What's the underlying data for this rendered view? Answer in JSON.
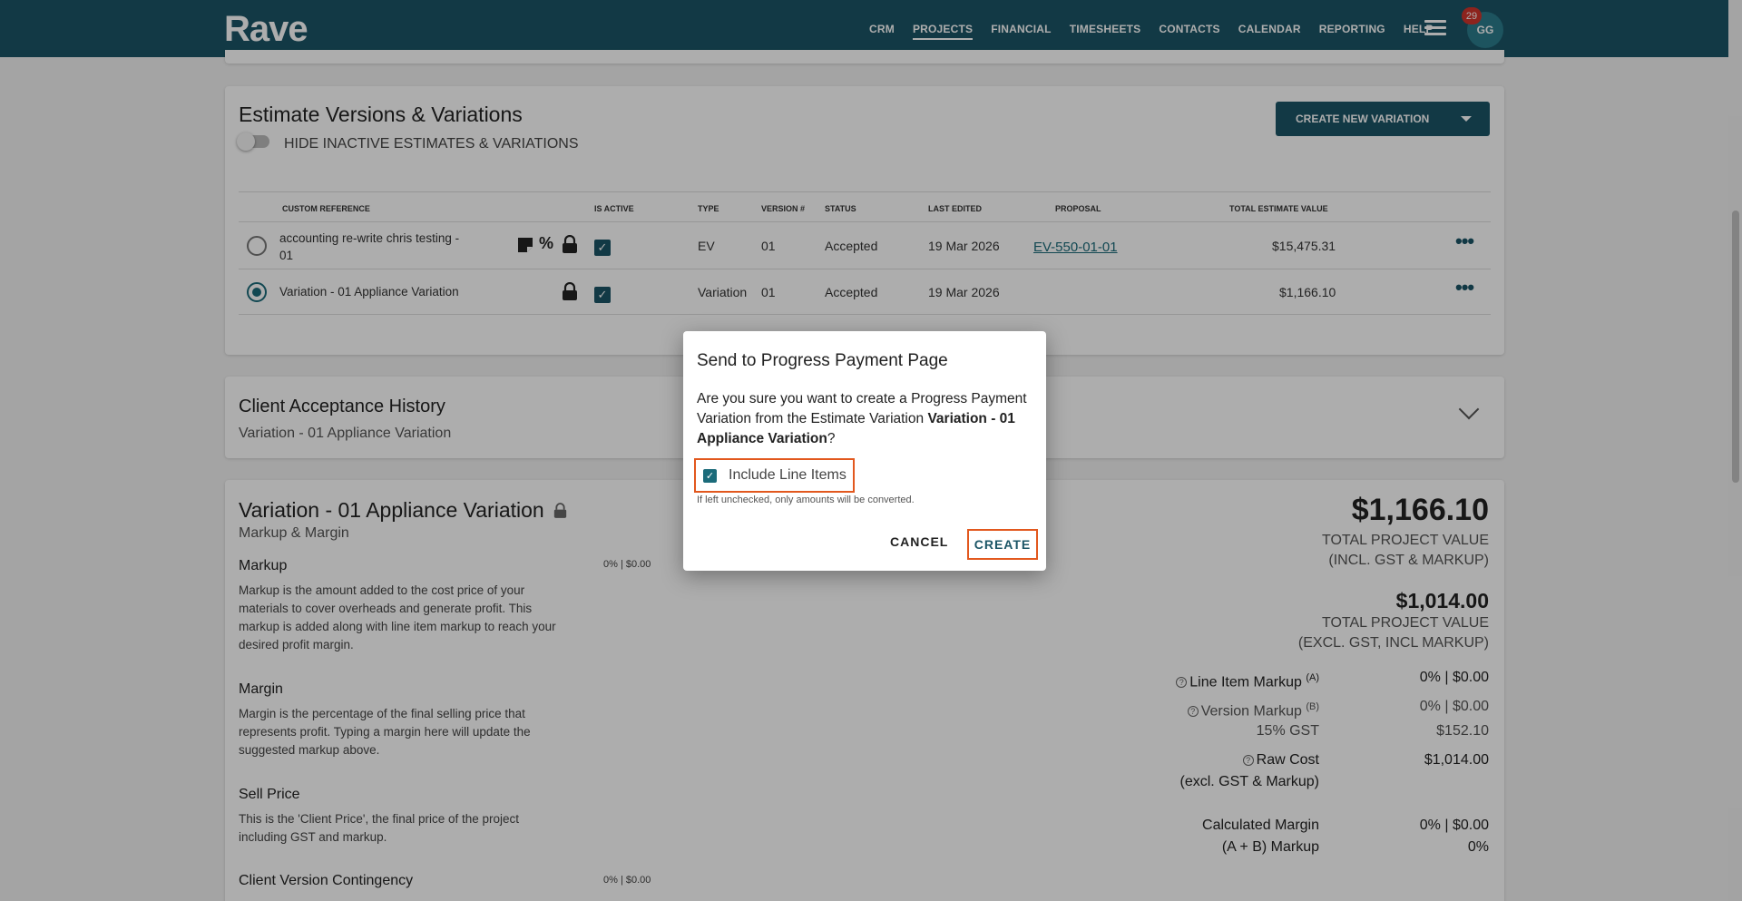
{
  "app": {
    "logo": "Rave"
  },
  "nav": {
    "items": [
      "CRM",
      "PROJECTS",
      "FINANCIAL",
      "TIMESHEETS",
      "CONTACTS",
      "CALENDAR",
      "REPORTING",
      "HELP"
    ],
    "active": "PROJECTS",
    "notifications": "29",
    "user_initials": "GG"
  },
  "versions": {
    "title": "Estimate Versions & Variations",
    "toggle_label": "HIDE INACTIVE ESTIMATES & VARIATIONS",
    "create_button": "CREATE NEW VARIATION",
    "columns": [
      "CUSTOM REFERENCE",
      "IS ACTIVE",
      "TYPE",
      "VERSION #",
      "STATUS",
      "LAST EDITED",
      "PROPOSAL",
      "TOTAL ESTIMATE VALUE"
    ],
    "rows": [
      {
        "ref_line1": "accounting re-write chris testing -",
        "ref_line2": "01",
        "type": "EV",
        "version": "01",
        "status": "Accepted",
        "last_edited": "19 Mar 2026",
        "proposal": "EV-550-01-01",
        "total": "$15,475.31"
      },
      {
        "ref_line1": "Variation - 01 Appliance Variation",
        "ref_line2": "",
        "type": "Variation",
        "version": "01",
        "status": "Accepted",
        "last_edited": "19 Mar 2026",
        "proposal": "",
        "total": "$1,166.10"
      }
    ]
  },
  "history": {
    "title": "Client Acceptance History",
    "subtitle": "Variation - 01 Appliance Variation"
  },
  "markup": {
    "title": "Variation - 01 Appliance Variation",
    "subtitle": "Markup & Margin",
    "sections": [
      {
        "title": "Markup",
        "desc": "Markup is the amount added to the cost price of your materials to cover overheads and generate profit. This markup is added along with line item markup to reach your desired profit margin.",
        "value": "0% | $0.00"
      },
      {
        "title": "Margin",
        "desc": "Margin is the percentage of the final selling price that represents profit. Typing a margin here will update the suggested markup above.",
        "value": ""
      },
      {
        "title": "Sell Price",
        "desc": "This is the 'Client Price', the final price of the project including GST and markup.",
        "value": ""
      },
      {
        "title": "Client Version Contingency",
        "desc": "",
        "value": "0% | $0.00"
      }
    ],
    "total_incl": "$1,166.10",
    "total_incl_label1": "TOTAL PROJECT VALUE",
    "total_incl_label2": "(INCL. GST & MARKUP)",
    "total_excl": "$1,014.00",
    "total_excl_label1": "TOTAL PROJECT VALUE",
    "total_excl_label2": "(EXCL. GST, INCL MARKUP)",
    "line_item_markup_label": "Line Item Markup",
    "line_item_markup_sup": "(A)",
    "line_item_markup_value": "0% | $0.00",
    "version_markup_label": "Version Markup",
    "version_markup_sup": "(B)",
    "version_markup_value": "0% | $0.00",
    "gst_label": "15% GST",
    "gst_value": "$152.10",
    "raw_cost_label": "Raw Cost",
    "raw_cost_sub": "(excl. GST & Markup)",
    "raw_cost_value": "$1,014.00",
    "calc_margin_label": "Calculated Margin",
    "calc_margin_value": "0% | $0.00",
    "ab_markup_label": "(A + B) Markup",
    "ab_markup_value": "0%"
  },
  "modal": {
    "title": "Send to Progress Payment Page",
    "message_prefix": "Are you sure you want to create a Progress Payment Variation from the Estimate Variation ",
    "message_bold": "Variation - 01 Appliance Variation",
    "message_suffix": "?",
    "checkbox_label": "Include Line Items",
    "checkbox_checked": true,
    "hint": "If left unchecked, only amounts will be converted.",
    "cancel": "CANCEL",
    "create": "CREATE"
  },
  "colors": {
    "brand": "#1b5566",
    "highlight": "#e2581e",
    "badge": "#d0342c"
  }
}
